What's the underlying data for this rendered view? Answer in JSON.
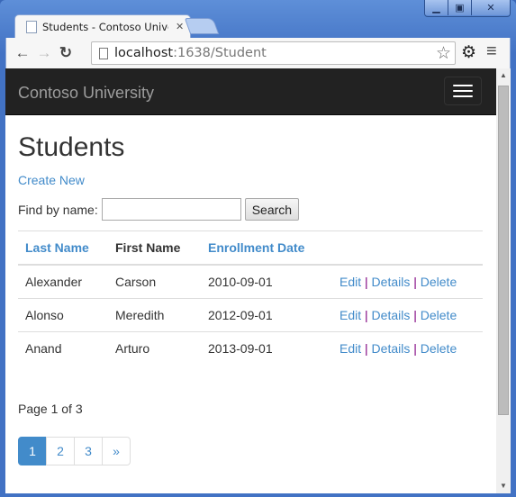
{
  "browser": {
    "tab_title": "Students - Contoso Univer",
    "url_host": "localhost",
    "url_rest": ":1638/Student",
    "window_controls": [
      "minimize",
      "maximize",
      "close"
    ]
  },
  "navbar": {
    "brand": "Contoso University"
  },
  "page": {
    "title": "Students",
    "create_new": "Create New",
    "search": {
      "label": "Find by name:",
      "value": "",
      "button": "Search"
    },
    "table": {
      "headers": [
        "Last Name",
        "First Name",
        "Enrollment Date",
        ""
      ],
      "rows": [
        {
          "last": "Alexander",
          "first": "Carson",
          "date": "2010-09-01"
        },
        {
          "last": "Alonso",
          "first": "Meredith",
          "date": "2012-09-01"
        },
        {
          "last": "Anand",
          "first": "Arturo",
          "date": "2013-09-01"
        }
      ],
      "actions": {
        "edit": "Edit",
        "details": "Details",
        "delete": "Delete",
        "separator": "|"
      }
    },
    "pager_info": "Page 1 of 3",
    "pagination": [
      "1",
      "2",
      "3",
      "»"
    ],
    "active_page": "1"
  },
  "colors": {
    "link": "#428bca",
    "navbar": "#222222",
    "active_page": "#428bca"
  }
}
